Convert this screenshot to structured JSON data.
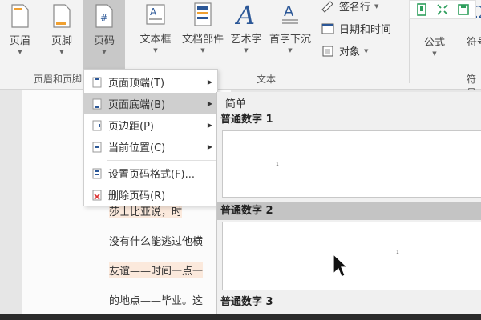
{
  "ribbon": {
    "buttons": {
      "header": "页眉",
      "footer": "页脚",
      "page_number": "页码",
      "text_box": "文本框",
      "quick_parts": "文档部件",
      "wordart": "艺术字",
      "drop_cap": "首字下沉",
      "equation": "公式",
      "symbol": "符号"
    },
    "small_buttons": {
      "signature_line": "签名行",
      "date_time": "日期和时间",
      "object": "对象"
    },
    "groups": {
      "header_footer": "页眉和页脚",
      "text": "文本",
      "symbols": "符号"
    }
  },
  "menu": {
    "items": [
      {
        "label": "页面顶端(T)"
      },
      {
        "label": "页面底端(B)"
      },
      {
        "label": "页边距(P)"
      },
      {
        "label": "当前位置(C)"
      },
      {
        "label": "设置页码格式(F)..."
      },
      {
        "label": "删除页码(R)"
      }
    ]
  },
  "gallery": {
    "category": "简单",
    "entries": [
      {
        "title": "普通数字 1",
        "page_num": "1"
      },
      {
        "title": "普通数字 2",
        "page_num": "1"
      },
      {
        "title": "普通数字 3"
      }
    ]
  },
  "document": {
    "lines": [
      "莎士比亚说，时",
      "没有什么能逃过他横",
      "友谊——时间一点一",
      "的地点——毕业。这"
    ]
  }
}
